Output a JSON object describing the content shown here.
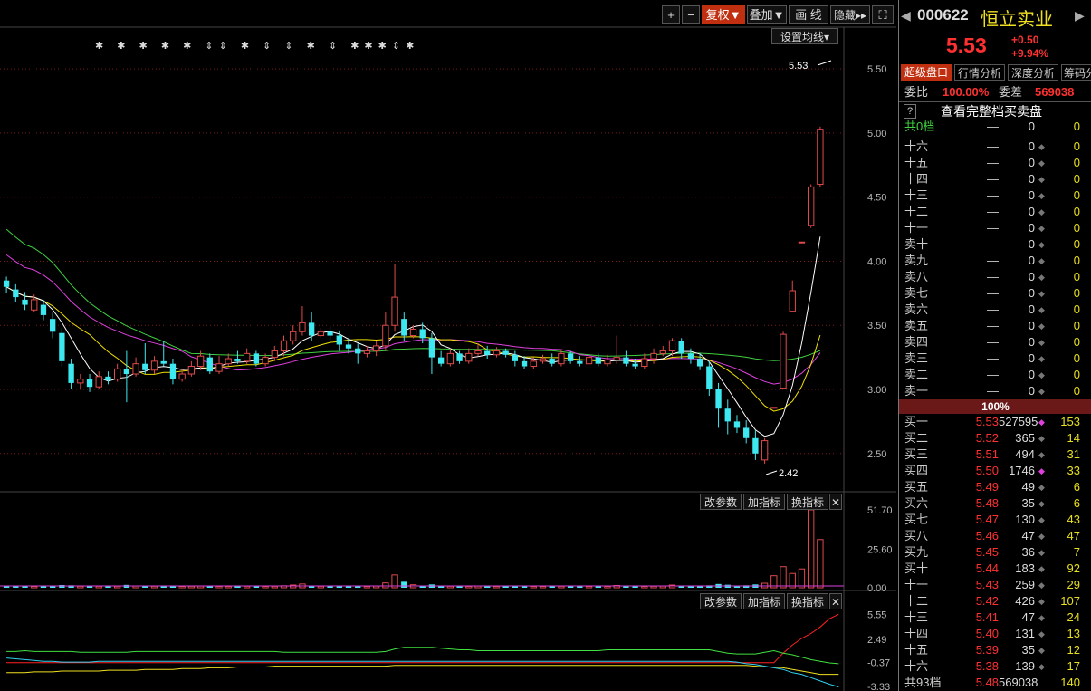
{
  "toolbar": {
    "plus": "+",
    "minus": "−",
    "adjust": "复权▼",
    "overlay": "叠加▼",
    "draw": "画 线",
    "hide": "隐藏▸▸",
    "fullscreen": "⛶",
    "ma_settings": "设置均线▾"
  },
  "main_chart": {
    "price_axis": [
      "5.50",
      "5.00",
      "4.50",
      "4.00",
      "3.50",
      "3.00",
      "2.50"
    ],
    "high_label": "5.53",
    "low_label": "2.42",
    "event_marks": "✱ ✱ ✱ ✱ ✱ ⇕⇕ ✱ ⇕ ⇕ ✱ ⇕ ✱✱✱⇕✱"
  },
  "volume_panel": {
    "axis": [
      "51.70",
      "25.60",
      "0.00"
    ],
    "btn_params": "改参数",
    "btn_add": "加指标",
    "btn_switch": "换指标",
    "btn_close": "✕"
  },
  "indicator_panel": {
    "axis": [
      "5.55",
      "2.49",
      "-0.37",
      "-3.33"
    ],
    "btn_params": "改参数",
    "btn_add": "加指标",
    "btn_switch": "换指标",
    "btn_close": "✕"
  },
  "colors": {
    "up": "#e04a4a",
    "down": "#3ee8f0",
    "ma5": "#ffffff",
    "ma10": "#f0e000",
    "ma20": "#e040e0",
    "ma60": "#40d040",
    "grid": "#7a1a1a",
    "axis_text": "#b8b8b8"
  },
  "chart_data": {
    "type": "candlestick",
    "ylim": [
      2.35,
      5.6
    ],
    "candles": [
      [
        3.85,
        3.8,
        3.88,
        3.75
      ],
      [
        3.78,
        3.72,
        3.82,
        3.68
      ],
      [
        3.7,
        3.66,
        3.76,
        3.62
      ],
      [
        3.62,
        3.7,
        3.74,
        3.6
      ],
      [
        3.66,
        3.58,
        3.7,
        3.54
      ],
      [
        3.55,
        3.45,
        3.6,
        3.4
      ],
      [
        3.44,
        3.22,
        3.48,
        3.18
      ],
      [
        3.2,
        3.05,
        3.24,
        3.0
      ],
      [
        3.05,
        3.08,
        3.12,
        3.0
      ],
      [
        3.08,
        3.02,
        3.12,
        2.98
      ],
      [
        3.02,
        3.1,
        3.14,
        3.0
      ],
      [
        3.1,
        3.07,
        3.14,
        3.04
      ],
      [
        3.08,
        3.16,
        3.2,
        3.06
      ],
      [
        3.16,
        3.12,
        3.3,
        2.9
      ],
      [
        3.12,
        3.2,
        3.25,
        3.1
      ],
      [
        3.2,
        3.15,
        3.36,
        3.12
      ],
      [
        3.15,
        3.22,
        3.26,
        3.12
      ],
      [
        3.22,
        3.2,
        3.38,
        3.18
      ],
      [
        3.2,
        3.08,
        3.24,
        3.04
      ],
      [
        3.08,
        3.12,
        3.16,
        3.06
      ],
      [
        3.12,
        3.18,
        3.22,
        3.1
      ],
      [
        3.18,
        3.26,
        3.3,
        3.15
      ],
      [
        3.25,
        3.14,
        3.28,
        3.12
      ],
      [
        3.14,
        3.2,
        3.26,
        3.12
      ],
      [
        3.2,
        3.24,
        3.28,
        3.18
      ],
      [
        3.24,
        3.22,
        3.3,
        3.2
      ],
      [
        3.22,
        3.28,
        3.32,
        3.2
      ],
      [
        3.28,
        3.2,
        3.3,
        3.18
      ],
      [
        3.2,
        3.25,
        3.28,
        3.18
      ],
      [
        3.25,
        3.3,
        3.34,
        3.22
      ],
      [
        3.3,
        3.38,
        3.42,
        3.26
      ],
      [
        3.38,
        3.45,
        3.5,
        3.35
      ],
      [
        3.45,
        3.52,
        3.65,
        3.42
      ],
      [
        3.52,
        3.42,
        3.6,
        3.38
      ],
      [
        3.42,
        3.45,
        3.48,
        3.4
      ],
      [
        3.45,
        3.42,
        3.5,
        3.38
      ],
      [
        3.42,
        3.35,
        3.46,
        3.3
      ],
      [
        3.35,
        3.32,
        3.4,
        3.28
      ],
      [
        3.32,
        3.28,
        3.36,
        3.2
      ],
      [
        3.28,
        3.3,
        3.34,
        3.25
      ],
      [
        3.3,
        3.34,
        3.38,
        3.26
      ],
      [
        3.34,
        3.5,
        3.6,
        3.3
      ],
      [
        3.5,
        3.72,
        3.98,
        3.45
      ],
      [
        3.55,
        3.42,
        3.6,
        3.38
      ],
      [
        3.42,
        3.47,
        3.5,
        3.4
      ],
      [
        3.47,
        3.4,
        3.52,
        3.36
      ],
      [
        3.4,
        3.25,
        3.44,
        3.12
      ],
      [
        3.25,
        3.2,
        3.3,
        3.18
      ],
      [
        3.2,
        3.28,
        3.32,
        3.18
      ],
      [
        3.28,
        3.22,
        3.3,
        3.2
      ],
      [
        3.22,
        3.28,
        3.32,
        3.2
      ],
      [
        3.28,
        3.3,
        3.36,
        3.26
      ],
      [
        3.3,
        3.27,
        3.34,
        3.24
      ],
      [
        3.27,
        3.3,
        3.33,
        3.25
      ],
      [
        3.3,
        3.27,
        3.32,
        3.25
      ],
      [
        3.27,
        3.22,
        3.3,
        3.18
      ],
      [
        3.22,
        3.18,
        3.26,
        3.16
      ],
      [
        3.18,
        3.22,
        3.25,
        3.16
      ],
      [
        3.22,
        3.24,
        3.27,
        3.2
      ],
      [
        3.24,
        3.2,
        3.28,
        3.18
      ],
      [
        3.2,
        3.28,
        3.31,
        3.18
      ],
      [
        3.28,
        3.22,
        3.3,
        3.2
      ],
      [
        3.22,
        3.2,
        3.26,
        3.18
      ],
      [
        3.2,
        3.25,
        3.28,
        3.18
      ],
      [
        3.25,
        3.2,
        3.28,
        3.18
      ],
      [
        3.2,
        3.23,
        3.27,
        3.18
      ],
      [
        3.23,
        3.25,
        3.42,
        3.2
      ],
      [
        3.25,
        3.2,
        3.3,
        3.18
      ],
      [
        3.2,
        3.18,
        3.24,
        3.16
      ],
      [
        3.18,
        3.24,
        3.28,
        3.16
      ],
      [
        3.24,
        3.28,
        3.32,
        3.2
      ],
      [
        3.28,
        3.3,
        3.34,
        3.26
      ],
      [
        3.3,
        3.38,
        3.4,
        3.26
      ],
      [
        3.38,
        3.28,
        3.4,
        3.24
      ],
      [
        3.28,
        3.24,
        3.32,
        3.2
      ],
      [
        3.24,
        3.18,
        3.28,
        3.15
      ],
      [
        3.18,
        3.0,
        3.22,
        2.95
      ],
      [
        3.0,
        2.85,
        3.05,
        2.7
      ],
      [
        2.85,
        2.75,
        2.92,
        2.65
      ],
      [
        2.75,
        2.7,
        2.8,
        2.66
      ],
      [
        2.7,
        2.62,
        2.76,
        2.58
      ],
      [
        2.62,
        2.5,
        2.68,
        2.45
      ],
      [
        2.45,
        2.6,
        2.62,
        2.42
      ],
      [
        2.86,
        2.86,
        2.86,
        2.86
      ],
      [
        3.01,
        3.43,
        3.45,
        3.01
      ],
      [
        3.61,
        3.77,
        3.85,
        3.61
      ],
      [
        4.15,
        4.15,
        4.15,
        4.15
      ],
      [
        4.28,
        4.58,
        4.6,
        4.26
      ],
      [
        4.6,
        5.03,
        5.05,
        4.58
      ]
    ],
    "volume": [
      1.2,
      1.0,
      1.1,
      0.9,
      1.0,
      1.4,
      1.8,
      1.6,
      1.0,
      0.9,
      1.0,
      0.8,
      1.0,
      1.9,
      1.1,
      1.2,
      1.0,
      1.1,
      1.3,
      0.9,
      1.0,
      1.1,
      1.0,
      0.9,
      0.8,
      0.9,
      1.0,
      0.9,
      0.8,
      1.0,
      1.3,
      1.8,
      2.5,
      1.5,
      1.0,
      1.1,
      1.2,
      1.0,
      1.3,
      0.9,
      1.1,
      3.2,
      8.5,
      4.0,
      2.0,
      1.5,
      2.2,
      1.2,
      1.0,
      1.0,
      0.9,
      1.1,
      1.0,
      0.9,
      0.8,
      1.0,
      1.0,
      0.9,
      0.8,
      0.9,
      1.0,
      0.9,
      0.8,
      0.9,
      1.0,
      0.8,
      1.5,
      0.9,
      0.8,
      0.9,
      1.0,
      1.1,
      1.8,
      1.2,
      1.0,
      1.1,
      1.6,
      2.5,
      2.0,
      1.5,
      1.6,
      2.2,
      3.0,
      8.0,
      14.0,
      9.5,
      12.5,
      51.7,
      32.0
    ],
    "indicator_series": [
      {
        "color": "#ff2020",
        "values": [
          -0.37,
          -0.37,
          -0.37,
          -0.37,
          -0.37,
          -0.37,
          -0.37,
          -0.37,
          -0.37,
          -0.37,
          -0.37,
          -0.37,
          -0.37,
          -0.37,
          -0.37,
          -0.37,
          -0.37,
          -0.37,
          -0.37,
          -0.37,
          -0.37,
          -0.37,
          -0.37,
          -0.37,
          -0.37,
          -0.37,
          -0.37,
          -0.37,
          -0.37,
          -0.37,
          -0.37,
          -0.37,
          -0.37,
          -0.37,
          -0.37,
          -0.37,
          -0.37,
          -0.37,
          -0.37,
          -0.37,
          -0.37,
          -0.37,
          -0.37,
          -0.37,
          -0.37,
          -0.37,
          -0.37,
          -0.37,
          -0.37,
          -0.37,
          -0.37,
          -0.37,
          -0.37,
          -0.37,
          -0.37,
          -0.37,
          -0.37,
          -0.37,
          -0.37,
          -0.37,
          -0.37,
          -0.37,
          -0.37,
          -0.37,
          -0.37,
          -0.37,
          -0.37,
          -0.37,
          -0.37,
          -0.37,
          -0.37,
          -0.37,
          -0.37,
          -0.37,
          -0.37,
          -0.37,
          -0.37,
          -0.37,
          -0.37,
          -0.37,
          -0.37,
          -0.37,
          -0.37,
          -0.37,
          0.8,
          1.8,
          2.6,
          3.2,
          4.0,
          5.0,
          5.55
        ]
      },
      {
        "color": "#40e040",
        "values": [
          1.0,
          1.0,
          1.1,
          1.0,
          1.0,
          1.0,
          1.0,
          1.0,
          0.9,
          0.9,
          0.9,
          0.9,
          0.9,
          0.9,
          1.0,
          1.0,
          1.0,
          1.0,
          1.0,
          1.0,
          1.0,
          1.0,
          1.0,
          1.0,
          1.0,
          1.0,
          1.0,
          1.0,
          1.0,
          1.0,
          0.9,
          0.9,
          0.9,
          0.9,
          0.9,
          0.9,
          0.9,
          0.9,
          0.9,
          0.9,
          0.9,
          1.0,
          1.3,
          1.5,
          1.5,
          1.5,
          1.5,
          1.4,
          1.3,
          1.2,
          1.2,
          1.1,
          1.1,
          1.1,
          1.1,
          1.1,
          1.1,
          1.1,
          1.1,
          1.1,
          1.1,
          1.1,
          1.1,
          1.1,
          1.1,
          1.2,
          1.2,
          1.2,
          1.2,
          1.2,
          1.2,
          1.2,
          1.2,
          1.2,
          1.2,
          1.2,
          1.2,
          1.0,
          0.8,
          0.7,
          0.7,
          0.7,
          0.9,
          1.1,
          0.8,
          0.6,
          0.3,
          0.0,
          -0.2,
          -0.4,
          -0.5
        ]
      },
      {
        "color": "#30d0f0",
        "values": [
          0.2,
          0.1,
          0.0,
          -0.1,
          -0.2,
          -0.2,
          -0.3,
          -0.3,
          -0.3,
          -0.3,
          -0.2,
          -0.2,
          -0.2,
          -0.2,
          -0.2,
          -0.2,
          -0.2,
          -0.2,
          -0.2,
          -0.2,
          -0.2,
          -0.2,
          -0.2,
          -0.2,
          -0.2,
          -0.2,
          -0.2,
          -0.2,
          -0.2,
          -0.2,
          -0.2,
          -0.2,
          -0.2,
          -0.2,
          -0.2,
          -0.2,
          -0.2,
          -0.2,
          -0.2,
          -0.2,
          -0.2,
          -0.2,
          -0.2,
          -0.2,
          -0.2,
          -0.2,
          -0.2,
          -0.2,
          -0.2,
          -0.2,
          -0.2,
          -0.2,
          -0.2,
          -0.2,
          -0.2,
          -0.2,
          -0.2,
          -0.2,
          -0.2,
          -0.2,
          -0.2,
          -0.2,
          -0.2,
          -0.2,
          -0.2,
          -0.2,
          -0.2,
          -0.2,
          -0.2,
          -0.2,
          -0.2,
          -0.2,
          -0.2,
          -0.2,
          -0.2,
          -0.2,
          -0.2,
          -0.2,
          -0.2,
          -0.3,
          -0.5,
          -0.6,
          -0.8,
          -1.0,
          -1.2,
          -1.6,
          -1.8,
          -2.2,
          -2.6,
          -3.0,
          -3.33
        ]
      },
      {
        "color": "#f0e020",
        "values": [
          -1.6,
          -1.6,
          -1.6,
          -1.5,
          -1.5,
          -1.5,
          -1.4,
          -1.4,
          -1.4,
          -1.4,
          -1.4,
          -1.3,
          -1.3,
          -1.3,
          -1.3,
          -1.2,
          -1.2,
          -1.2,
          -1.2,
          -1.1,
          -1.1,
          -1.1,
          -1.0,
          -1.0,
          -1.0,
          -0.9,
          -0.9,
          -0.9,
          -0.9,
          -0.8,
          -0.8,
          -0.8,
          -0.8,
          -0.8,
          -0.8,
          -0.8,
          -0.8,
          -0.8,
          -0.8,
          -0.8,
          -0.8,
          -0.8,
          -0.7,
          -0.7,
          -0.7,
          -0.7,
          -0.7,
          -0.7,
          -0.7,
          -0.7,
          -0.7,
          -0.7,
          -0.7,
          -0.7,
          -0.7,
          -0.7,
          -0.7,
          -0.7,
          -0.7,
          -0.7,
          -0.7,
          -0.7,
          -0.7,
          -0.7,
          -0.7,
          -0.7,
          -0.7,
          -0.7,
          -0.7,
          -0.7,
          -0.7,
          -0.7,
          -0.7,
          -0.7,
          -0.7,
          -0.7,
          -0.7,
          -0.7,
          -0.7,
          -0.7,
          -0.7,
          -0.8,
          -0.9,
          -0.9,
          -1.0,
          -1.2,
          -1.4,
          -1.6,
          -1.8,
          -1.8,
          -1.8
        ]
      }
    ],
    "indicator_ylim": [
      -3.5,
      5.8
    ]
  },
  "stock": {
    "code": "000622",
    "name": "恒立实业",
    "price": "5.53",
    "change": "+0.50",
    "pct": "+9.94%",
    "tabs": [
      "超级盘口",
      "行情分析",
      "深度分析",
      "筹码分"
    ],
    "weibi_label": "委比",
    "weibi_value": "100.00%",
    "weicha_label": "委差",
    "weicha_value": "569038",
    "help": "?",
    "view_full": "查看完整档买卖盘",
    "ask_total": {
      "label": "共0档",
      "price": "—",
      "vol": "0",
      "cnt": "0"
    },
    "asks": [
      {
        "label": "十六",
        "price": "—",
        "vol": "0",
        "cnt": "0"
      },
      {
        "label": "十五",
        "price": "—",
        "vol": "0",
        "cnt": "0"
      },
      {
        "label": "十四",
        "price": "—",
        "vol": "0",
        "cnt": "0"
      },
      {
        "label": "十三",
        "price": "—",
        "vol": "0",
        "cnt": "0"
      },
      {
        "label": "十二",
        "price": "—",
        "vol": "0",
        "cnt": "0"
      },
      {
        "label": "十一",
        "price": "—",
        "vol": "0",
        "cnt": "0"
      },
      {
        "label": "卖十",
        "price": "—",
        "vol": "0",
        "cnt": "0"
      },
      {
        "label": "卖九",
        "price": "—",
        "vol": "0",
        "cnt": "0"
      },
      {
        "label": "卖八",
        "price": "—",
        "vol": "0",
        "cnt": "0"
      },
      {
        "label": "卖七",
        "price": "—",
        "vol": "0",
        "cnt": "0"
      },
      {
        "label": "卖六",
        "price": "—",
        "vol": "0",
        "cnt": "0"
      },
      {
        "label": "卖五",
        "price": "—",
        "vol": "0",
        "cnt": "0"
      },
      {
        "label": "卖四",
        "price": "—",
        "vol": "0",
        "cnt": "0"
      },
      {
        "label": "卖三",
        "price": "—",
        "vol": "0",
        "cnt": "0"
      },
      {
        "label": "卖二",
        "price": "—",
        "vol": "0",
        "cnt": "0"
      },
      {
        "label": "卖一",
        "price": "—",
        "vol": "0",
        "cnt": "0"
      }
    ],
    "ratio_bar": "100%",
    "bids": [
      {
        "label": "买一",
        "price": "5.53",
        "vol": "527595",
        "cnt": "153",
        "mark": "◆"
      },
      {
        "label": "买二",
        "price": "5.52",
        "vol": "365",
        "cnt": "14",
        "mark": "◆"
      },
      {
        "label": "买三",
        "price": "5.51",
        "vol": "494",
        "cnt": "31",
        "mark": "◆"
      },
      {
        "label": "买四",
        "price": "5.50",
        "vol": "1746",
        "cnt": "33",
        "mark": "◆"
      },
      {
        "label": "买五",
        "price": "5.49",
        "vol": "49",
        "cnt": "6",
        "mark": "◆"
      },
      {
        "label": "买六",
        "price": "5.48",
        "vol": "35",
        "cnt": "6",
        "mark": "◆"
      },
      {
        "label": "买七",
        "price": "5.47",
        "vol": "130",
        "cnt": "43",
        "mark": "◆"
      },
      {
        "label": "买八",
        "price": "5.46",
        "vol": "47",
        "cnt": "47",
        "mark": "◆"
      },
      {
        "label": "买九",
        "price": "5.45",
        "vol": "36",
        "cnt": "7",
        "mark": "◆"
      },
      {
        "label": "买十",
        "price": "5.44",
        "vol": "183",
        "cnt": "92",
        "mark": "◆"
      },
      {
        "label": "十一",
        "price": "5.43",
        "vol": "259",
        "cnt": "29",
        "mark": "◆"
      },
      {
        "label": "十二",
        "price": "5.42",
        "vol": "426",
        "cnt": "107",
        "mark": "◆"
      },
      {
        "label": "十三",
        "price": "5.41",
        "vol": "47",
        "cnt": "24",
        "mark": "◆"
      },
      {
        "label": "十四",
        "price": "5.40",
        "vol": "131",
        "cnt": "13",
        "mark": "◆"
      },
      {
        "label": "十五",
        "price": "5.39",
        "vol": "35",
        "cnt": "12",
        "mark": "◆"
      },
      {
        "label": "十六",
        "price": "5.38",
        "vol": "139",
        "cnt": "17",
        "mark": "◆"
      }
    ],
    "bid_total": {
      "label": "共93档",
      "price": "5.48",
      "vol": "569038",
      "cnt": "140"
    }
  }
}
